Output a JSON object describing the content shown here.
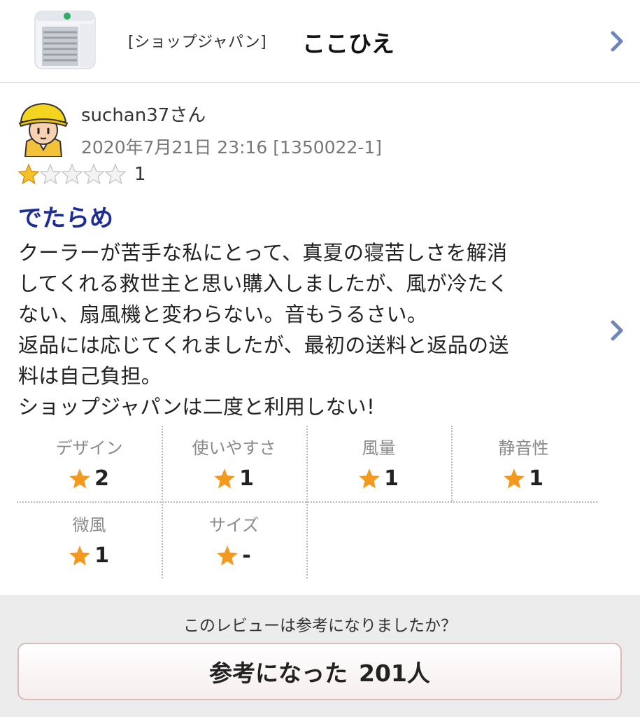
{
  "header": {
    "shop": "[ショップジャパン]",
    "product": "ここひえ"
  },
  "review": {
    "username": "suchan37さん",
    "meta": "2020年7月21日 23:16 [1350022-1]",
    "rating": 1,
    "rating_max": 5,
    "rating_text": "1",
    "title": "でたらめ",
    "body_lines": [
      "クーラーが苦手な私にとって、真夏の寝苦しさを解消",
      "してくれる救世主と思い購入しましたが、風が冷たく",
      "ない、扇風機と変わらない。音もうるさい。",
      "返品には応じてくれましたが、最初の送料と返品の送",
      "料は自己負担。",
      "ショップジャパンは二度と利用しない!"
    ]
  },
  "ratings": [
    {
      "label": "デザイン",
      "value": "2"
    },
    {
      "label": "使いやすさ",
      "value": "1"
    },
    {
      "label": "風量",
      "value": "1"
    },
    {
      "label": "静音性",
      "value": "1"
    },
    {
      "label": "微風",
      "value": "1"
    },
    {
      "label": "サイズ",
      "value": "-"
    }
  ],
  "footer": {
    "question": "このレビューは参考になりましたか？",
    "button_label": "参考になった",
    "count": "201人"
  },
  "colors": {
    "title": "#1c2d96",
    "star": "#f39a1e",
    "chevron": "#6f86bd",
    "footer_bg": "#ececec"
  },
  "icons": {
    "product": "product-thumbnail-icon",
    "avatar": "user-avatar-icon",
    "chevron": "chevron-right-icon",
    "star": "star-icon"
  }
}
